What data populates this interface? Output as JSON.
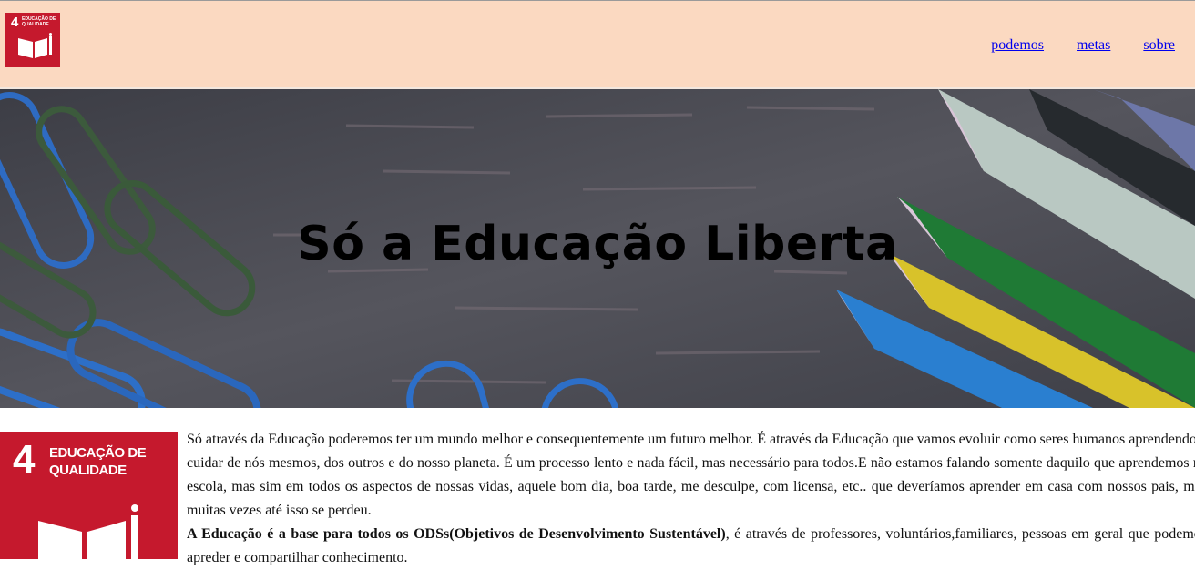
{
  "header": {
    "logo_number": "4",
    "logo_text": "EDUCAÇÃO DE QUALIDADE",
    "nav": [
      "podemos",
      "metas",
      "sobre"
    ]
  },
  "hero": {
    "title": "Só a Educação Liberta"
  },
  "sdg_card": {
    "number": "4",
    "title_line1": "EDUCAÇÃO DE",
    "title_line2": "QUALIDADE"
  },
  "content": {
    "paragraph1": "Só através da Educação poderemos ter um mundo melhor e consequentemente um futuro melhor. É através da Educação que vamos evoluir como seres humanos aprendendo a cuidar de nós mesmos, dos outros e do nosso planeta. É um processo lento e nada fácil, mas necessário para todos.E não estamos falando somente daquilo que aprendemos na escola, mas sim em todos os aspectos de nossas vidas, aquele bom dia, boa tarde, me desculpe, com licensa, etc.. que deveríamos aprender em casa com nossos pais, mas muitas vezes até isso se perdeu.",
    "paragraph2_bold": "A Educação é a base para todos os ODSs(Objetivos de Desenvolvimento Sustentável)",
    "paragraph2_rest": ", é através de professores, voluntários,familiares, pessoas em geral que podemos apreder e compartilhar conhecimento."
  },
  "colors": {
    "header_bg": "#fbd9c1",
    "sdg_red": "#c5192d",
    "link": "#0000ee"
  }
}
